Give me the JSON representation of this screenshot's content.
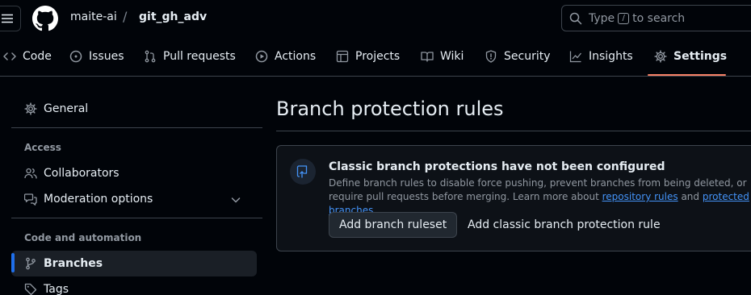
{
  "header": {
    "owner": "maite-ai",
    "separator": "/",
    "repo": "git_gh_adv",
    "search_before": "Type",
    "search_key": "/",
    "search_after": "to search"
  },
  "tabs": [
    {
      "label": "Code",
      "icon": "code-icon"
    },
    {
      "label": "Issues",
      "icon": "issue-icon"
    },
    {
      "label": "Pull requests",
      "icon": "pull-request-icon"
    },
    {
      "label": "Actions",
      "icon": "play-icon"
    },
    {
      "label": "Projects",
      "icon": "table-icon"
    },
    {
      "label": "Wiki",
      "icon": "book-icon"
    },
    {
      "label": "Security",
      "icon": "shield-icon"
    },
    {
      "label": "Insights",
      "icon": "graph-icon"
    },
    {
      "label": "Settings",
      "icon": "gear-icon",
      "active": true
    }
  ],
  "sidebar": {
    "general": "General",
    "access_heading": "Access",
    "collaborators": "Collaborators",
    "moderation": "Moderation options",
    "code_heading": "Code and automation",
    "branches": "Branches",
    "tags": "Tags"
  },
  "main": {
    "title": "Branch protection rules",
    "card": {
      "title": "Classic branch protections have not been configured",
      "desc_prefix": "Define branch rules to disable force pushing, prevent branches from being deleted, or require pull requests before merging. Learn more about",
      "link_rules": "repository rules",
      "desc_and": "and",
      "link_protected": "protected branches",
      "desc_end": ".",
      "add_ruleset": "Add branch ruleset",
      "add_classic": "Add classic branch protection rule"
    }
  },
  "colors": {
    "accent_underline": "#f78166",
    "active_bar": "#1f6feb",
    "link": "#4493f8"
  }
}
